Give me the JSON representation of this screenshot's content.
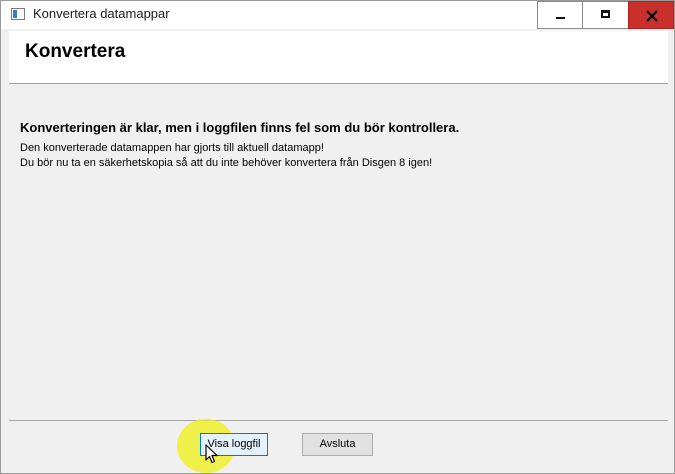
{
  "window": {
    "title": "Konvertera datamappar"
  },
  "header": {
    "title": "Konvertera"
  },
  "message": {
    "heading": "Konverteringen är klar, men i loggfilen finns fel som du bör kontrollera.",
    "line1": "Den konverterade datamappen har gjorts till aktuell datamapp!",
    "line2": "Du bör nu ta en säkerhetskopia så att du inte behöver konvertera från Disgen 8 igen!"
  },
  "buttons": {
    "show_log": "Visa loggfil",
    "exit": "Avsluta"
  },
  "colors": {
    "close_button": "#c9302c",
    "cursor_highlight": "#f0f014",
    "focus_border": "#0078d7"
  }
}
